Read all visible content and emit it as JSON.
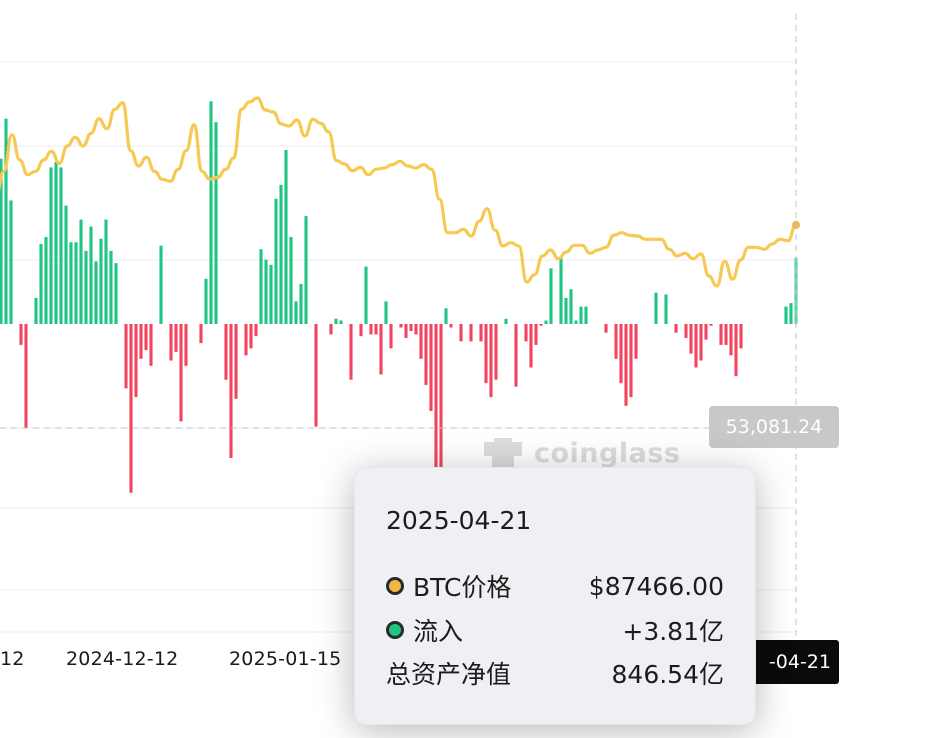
{
  "chart_data": {
    "type": "bar",
    "title": "",
    "xlabel": "",
    "ylabel": "",
    "x_tick_labels": [
      "12",
      "2024-12-12",
      "2025-01-15",
      "-04-21"
    ],
    "series": [
      {
        "name": "BTC价格",
        "type": "line",
        "color": "#f8c952",
        "values": [
          92000,
          95500,
          101000,
          97200,
          95000,
          95500,
          97200,
          98500,
          96700,
          99300,
          100600,
          99300,
          101200,
          103400,
          101900,
          104800,
          105800,
          98600,
          96300,
          97600,
          95500,
          94300,
          94000,
          95800,
          98600,
          102500,
          95500,
          94300,
          94600,
          95800,
          97500,
          104800,
          105900,
          106500,
          104700,
          104400,
          102600,
          102300,
          103200,
          100800,
          103300,
          102700,
          101400,
          97100,
          96600,
          95600,
          96100,
          95000,
          95800,
          96000,
          96500,
          97000,
          96300,
          96000,
          96500,
          95800,
          91300,
          86300,
          86300,
          86800,
          85800,
          88000,
          89900,
          86700,
          84300,
          84800,
          84300,
          78900,
          80000,
          82800,
          83700,
          82400,
          83400,
          84400,
          84400,
          83200,
          83700,
          84100,
          85900,
          86300,
          85900,
          85800,
          85300,
          85300,
          85300,
          83800,
          82800,
          83200,
          82400,
          83100,
          79800,
          78300,
          82000,
          79300,
          82200,
          84100,
          84100,
          83800,
          84600,
          85300,
          85100,
          87466
        ]
      },
      {
        "name": "流入",
        "type": "bar",
        "color_positive": "#1ec583",
        "color_negative": "#f1445e",
        "unit": "亿",
        "values": [
          9.5,
          9.5,
          11.8,
          7.1,
          0,
          -1.2,
          -6.0,
          0,
          1.5,
          4.6,
          5.0,
          9.0,
          9.3,
          9.0,
          6.8,
          4.7,
          4.7,
          6.0,
          4.2,
          5.6,
          3.6,
          4.9,
          6.0,
          4.2,
          3.5,
          0,
          -3.7,
          -9.7,
          -4.2,
          -2.0,
          -1.5,
          -2.4,
          0,
          4.5,
          0,
          -2.1,
          -1.6,
          -5.6,
          -2.4,
          0,
          0,
          -1.1,
          2.6,
          12.8,
          11.6,
          0,
          -3.2,
          -7.7,
          -4.3,
          0,
          -1.8,
          -1.4,
          -0.7,
          4.3,
          3.7,
          3.4,
          7.2,
          8.0,
          10.0,
          5.0,
          1.3,
          2.3,
          6.2,
          0,
          -5.9,
          0,
          0,
          -0.6,
          0.3,
          0.2,
          0,
          -3.2,
          0,
          -0.7,
          3.3,
          -0.6,
          -0.6,
          -2.9,
          1.3,
          -1.4,
          0,
          -0.2,
          -0.8,
          -0.4,
          -0.6,
          -2.0,
          -3.5,
          -5.0,
          -9.0,
          -9.0,
          0.9,
          -0.2,
          0,
          -1.0,
          0,
          -1.0,
          0,
          -1.0,
          -3.4,
          -4.2,
          -3.2,
          0,
          0.3,
          0,
          -3.6,
          0,
          -1.0,
          -2.5,
          -1.2,
          -0.1,
          0.2,
          3.2,
          0,
          3.8,
          1.5,
          2.0,
          0.2,
          1.0,
          1.0,
          0,
          0,
          0,
          -0.5,
          0,
          -2.0,
          -3.4,
          -4.7,
          -4.2,
          -2.0,
          0,
          0,
          0,
          1.8,
          0,
          1.7,
          0,
          -0.5,
          0,
          -0.8,
          -1.7,
          -2.5,
          -2.1,
          -0.9,
          -0.1,
          0,
          -1.2,
          -1.2,
          -1.8,
          -3.0,
          -1.4,
          0,
          0,
          0,
          0,
          0,
          0,
          0,
          0,
          1.0,
          1.2,
          3.81
        ]
      }
    ],
    "crosshair": {
      "x_label": "-04-21",
      "y_label": "53,081.24"
    },
    "watermark": "coinglass",
    "grid": true
  },
  "tooltip": {
    "date": "2025-04-21",
    "rows": [
      {
        "label": "BTC价格",
        "value": "$87466.00",
        "dot_color": "#f3b645"
      },
      {
        "label": "流入",
        "value": "+3.81亿",
        "dot_color": "#1ec583"
      },
      {
        "label": "总资产净值",
        "value": "846.54亿"
      }
    ]
  }
}
